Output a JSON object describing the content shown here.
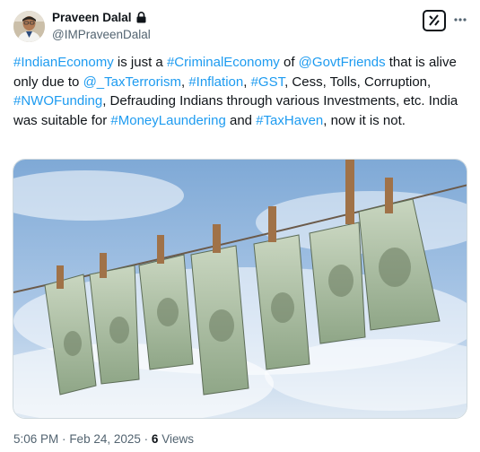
{
  "author": {
    "name": "Praveen Dalal",
    "handle": "@IMPraveenDalal"
  },
  "icons": {
    "lock": "lock-icon",
    "grok": "grok-icon",
    "more": "more-options-icon"
  },
  "post": {
    "segments": [
      {
        "text": "#IndianEconomy",
        "link": true
      },
      {
        "text": " is just a ",
        "link": false
      },
      {
        "text": "#CriminalEconomy",
        "link": true
      },
      {
        "text": " of ",
        "link": false
      },
      {
        "text": "@GovtFriends",
        "link": true
      },
      {
        "text": " that is alive only due to ",
        "link": false
      },
      {
        "text": "@_TaxTerrorism",
        "link": true
      },
      {
        "text": ", ",
        "link": false
      },
      {
        "text": "#Inflation",
        "link": true
      },
      {
        "text": ", ",
        "link": false
      },
      {
        "text": "#GST",
        "link": true
      },
      {
        "text": ", Cess, Tolls, Corruption, ",
        "link": false
      },
      {
        "text": "#NWOFunding",
        "link": true
      },
      {
        "text": ", Defrauding Indians through various Investments, etc. India was suitable for ",
        "link": false
      },
      {
        "text": "#MoneyLaundering",
        "link": true
      },
      {
        "text": " and ",
        "link": false
      },
      {
        "text": "#TaxHaven",
        "link": true
      },
      {
        "text": ", now it is not.",
        "link": false
      }
    ]
  },
  "media": {
    "alt": "Dollar bills hanging on a clothesline with wooden pegs against a blue sky"
  },
  "meta": {
    "time": "5:06 PM",
    "separator": "·",
    "date": "Feb 24, 2025",
    "views_count": "6",
    "views_label": "Views"
  },
  "colors": {
    "link": "#1d9bf0",
    "secondary_text": "#536471",
    "primary_text": "#0f1419"
  }
}
